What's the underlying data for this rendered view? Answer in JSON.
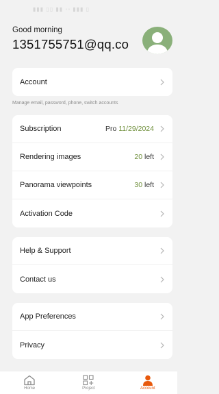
{
  "header": {
    "greeting": "Good morning",
    "email": "1351755751@qq.co"
  },
  "account_section": {
    "account_label": "Account",
    "hint": "Manage  email, password,  phone, switch accounts"
  },
  "subscription_section": {
    "items": [
      {
        "label": "Subscription",
        "value_prefix": "Pro ",
        "value_accent": "11/29/2024"
      },
      {
        "label": "Rendering images",
        "value_accent": "20",
        "value_suffix": " left"
      },
      {
        "label": "Panorama viewpoints",
        "value_accent": "30",
        "value_suffix": " left"
      },
      {
        "label": "Activation Code"
      }
    ]
  },
  "support_section": {
    "items": [
      {
        "label": "Help & Support"
      },
      {
        "label": "Contact us"
      }
    ]
  },
  "preferences_section": {
    "items": [
      {
        "label": "App Preferences"
      },
      {
        "label": "Privacy"
      }
    ]
  },
  "tabbar": {
    "tabs": [
      {
        "label": "Home",
        "icon": "home-icon"
      },
      {
        "label": "Project",
        "icon": "project-grid-icon"
      },
      {
        "label": "Account",
        "icon": "account-person-icon",
        "active": true
      }
    ]
  },
  "colors": {
    "accent_green": "#6f8f3b",
    "active_tab": "#e8590c",
    "background": "#f2f2f2"
  }
}
